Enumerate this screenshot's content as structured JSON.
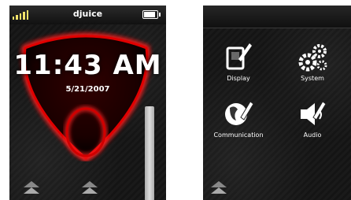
{
  "lock_screen": {
    "operator": "djuice",
    "time": "11:43 AM",
    "date": "5/21/2007"
  },
  "menu_screen": {
    "items": [
      {
        "label": "Display",
        "icon": "display-icon"
      },
      {
        "label": "System",
        "icon": "gears-icon"
      },
      {
        "label": "Communication",
        "icon": "communication-icon"
      },
      {
        "label": "Audio",
        "icon": "audio-icon"
      }
    ]
  },
  "colors": {
    "accent_red": "#e00000",
    "signal_yellow": "#f3e36a"
  }
}
